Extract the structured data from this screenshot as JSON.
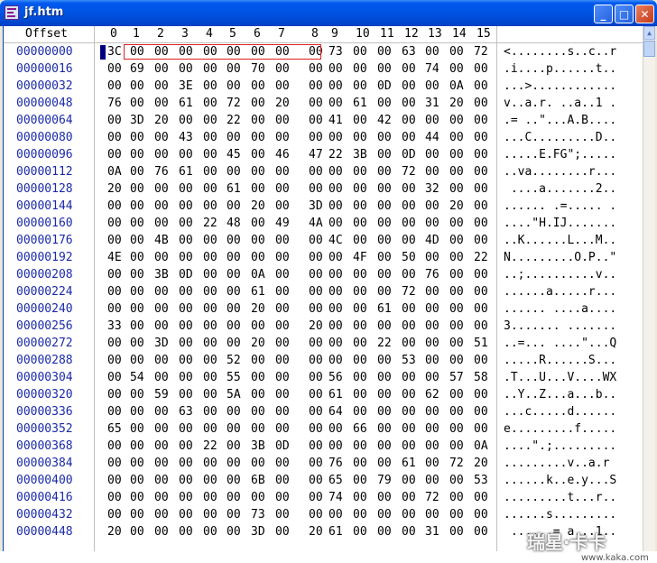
{
  "window": {
    "title": "jf.htm",
    "minimize_symbol": "_",
    "maximize_symbol": "□",
    "close_symbol": "✕"
  },
  "header": {
    "offset_label": "Offset",
    "columns": [
      "0",
      "1",
      "2",
      "3",
      "4",
      "5",
      "6",
      "7",
      "8",
      "9",
      "10",
      "11",
      "12",
      "13",
      "14",
      "15"
    ]
  },
  "offsets": [
    "00000000",
    "00000016",
    "00000032",
    "00000048",
    "00000064",
    "00000080",
    "00000096",
    "00000112",
    "00000128",
    "00000144",
    "00000160",
    "00000176",
    "00000192",
    "00000208",
    "00000224",
    "00000240",
    "00000256",
    "00000272",
    "00000288",
    "00000304",
    "00000320",
    "00000336",
    "00000352",
    "00000368",
    "00000384",
    "00000400",
    "00000416",
    "00000432",
    "00000448"
  ],
  "hex_rows": [
    [
      "3C",
      "00",
      "00",
      "00",
      "00",
      "00",
      "00",
      "00",
      "00",
      "73",
      "00",
      "00",
      "63",
      "00",
      "00",
      "72"
    ],
    [
      "00",
      "69",
      "00",
      "00",
      "00",
      "00",
      "70",
      "00",
      "00",
      "00",
      "00",
      "00",
      "00",
      "74",
      "00",
      "00"
    ],
    [
      "00",
      "00",
      "00",
      "3E",
      "00",
      "00",
      "00",
      "00",
      "00",
      "00",
      "00",
      "0D",
      "00",
      "00",
      "0A",
      "00"
    ],
    [
      "76",
      "00",
      "00",
      "61",
      "00",
      "72",
      "00",
      "20",
      "00",
      "00",
      "61",
      "00",
      "00",
      "31",
      "20",
      "00"
    ],
    [
      "00",
      "3D",
      "20",
      "00",
      "00",
      "22",
      "00",
      "00",
      "00",
      "41",
      "00",
      "42",
      "00",
      "00",
      "00",
      "00"
    ],
    [
      "00",
      "00",
      "00",
      "43",
      "00",
      "00",
      "00",
      "00",
      "00",
      "00",
      "00",
      "00",
      "00",
      "44",
      "00",
      "00"
    ],
    [
      "00",
      "00",
      "00",
      "00",
      "00",
      "45",
      "00",
      "46",
      "47",
      "22",
      "3B",
      "00",
      "0D",
      "00",
      "00",
      "00"
    ],
    [
      "0A",
      "00",
      "76",
      "61",
      "00",
      "00",
      "00",
      "00",
      "00",
      "00",
      "00",
      "00",
      "72",
      "00",
      "00",
      "00"
    ],
    [
      "20",
      "00",
      "00",
      "00",
      "00",
      "61",
      "00",
      "00",
      "00",
      "00",
      "00",
      "00",
      "00",
      "32",
      "00",
      "00"
    ],
    [
      "00",
      "00",
      "00",
      "00",
      "00",
      "00",
      "20",
      "00",
      "3D",
      "00",
      "00",
      "00",
      "00",
      "00",
      "20",
      "00"
    ],
    [
      "00",
      "00",
      "00",
      "00",
      "22",
      "48",
      "00",
      "49",
      "4A",
      "00",
      "00",
      "00",
      "00",
      "00",
      "00",
      "00"
    ],
    [
      "00",
      "00",
      "4B",
      "00",
      "00",
      "00",
      "00",
      "00",
      "00",
      "4C",
      "00",
      "00",
      "00",
      "4D",
      "00",
      "00"
    ],
    [
      "4E",
      "00",
      "00",
      "00",
      "00",
      "00",
      "00",
      "00",
      "00",
      "00",
      "4F",
      "00",
      "50",
      "00",
      "00",
      "22"
    ],
    [
      "00",
      "00",
      "3B",
      "0D",
      "00",
      "00",
      "0A",
      "00",
      "00",
      "00",
      "00",
      "00",
      "00",
      "76",
      "00",
      "00"
    ],
    [
      "00",
      "00",
      "00",
      "00",
      "00",
      "00",
      "61",
      "00",
      "00",
      "00",
      "00",
      "00",
      "72",
      "00",
      "00",
      "00"
    ],
    [
      "00",
      "00",
      "00",
      "00",
      "00",
      "00",
      "20",
      "00",
      "00",
      "00",
      "00",
      "61",
      "00",
      "00",
      "00",
      "00"
    ],
    [
      "33",
      "00",
      "00",
      "00",
      "00",
      "00",
      "00",
      "00",
      "20",
      "00",
      "00",
      "00",
      "00",
      "00",
      "00",
      "00"
    ],
    [
      "00",
      "00",
      "3D",
      "00",
      "00",
      "00",
      "20",
      "00",
      "00",
      "00",
      "00",
      "22",
      "00",
      "00",
      "00",
      "51"
    ],
    [
      "00",
      "00",
      "00",
      "00",
      "00",
      "52",
      "00",
      "00",
      "00",
      "00",
      "00",
      "00",
      "53",
      "00",
      "00",
      "00"
    ],
    [
      "00",
      "54",
      "00",
      "00",
      "00",
      "55",
      "00",
      "00",
      "00",
      "56",
      "00",
      "00",
      "00",
      "00",
      "57",
      "58"
    ],
    [
      "00",
      "00",
      "59",
      "00",
      "00",
      "5A",
      "00",
      "00",
      "00",
      "61",
      "00",
      "00",
      "00",
      "62",
      "00",
      "00"
    ],
    [
      "00",
      "00",
      "00",
      "63",
      "00",
      "00",
      "00",
      "00",
      "00",
      "64",
      "00",
      "00",
      "00",
      "00",
      "00",
      "00"
    ],
    [
      "65",
      "00",
      "00",
      "00",
      "00",
      "00",
      "00",
      "00",
      "00",
      "00",
      "66",
      "00",
      "00",
      "00",
      "00",
      "00"
    ],
    [
      "00",
      "00",
      "00",
      "00",
      "22",
      "00",
      "3B",
      "0D",
      "00",
      "00",
      "00",
      "00",
      "00",
      "00",
      "00",
      "0A"
    ],
    [
      "00",
      "00",
      "00",
      "00",
      "00",
      "00",
      "00",
      "00",
      "00",
      "76",
      "00",
      "00",
      "61",
      "00",
      "72",
      "20"
    ],
    [
      "00",
      "00",
      "00",
      "00",
      "00",
      "00",
      "6B",
      "00",
      "00",
      "65",
      "00",
      "79",
      "00",
      "00",
      "00",
      "53"
    ],
    [
      "00",
      "00",
      "00",
      "00",
      "00",
      "00",
      "00",
      "00",
      "00",
      "74",
      "00",
      "00",
      "00",
      "72",
      "00",
      "00"
    ],
    [
      "00",
      "00",
      "00",
      "00",
      "00",
      "00",
      "73",
      "00",
      "00",
      "00",
      "00",
      "00",
      "00",
      "00",
      "00",
      "00"
    ],
    [
      "20",
      "00",
      "00",
      "00",
      "00",
      "00",
      "3D",
      "00",
      "20",
      "61",
      "00",
      "00",
      "00",
      "31",
      "00",
      "00"
    ]
  ],
  "ascii_rows": [
    "<........s..c..r",
    ".i....p......t..",
    "...>............",
    "v..a.r. ..a..1 .",
    ".= ..\"...A.B....",
    "...C.........D..",
    ".....E.FG\";.....",
    "..va........r...",
    " ....a.......2..",
    "...... .=..... .",
    "....\"H.IJ.......",
    "..K......L...M..",
    "N.........O.P..\"",
    "..;..........v..",
    "......a.....r...",
    "...... ....a....",
    "3....... .......",
    "..=... ....\"...Q",
    ".....R......S...",
    ".T...U...V....WX",
    "..Y..Z...a...b..",
    "...c.....d......",
    "e.........f.....",
    "....\".;.........",
    ".........v..a.r ",
    "......k..e.y...S",
    ".........t...r..",
    "......s.........",
    " ......= a...1.."
  ],
  "watermark": {
    "text": "瑞星·卡卡",
    "subtext": "www.kaka.com"
  }
}
